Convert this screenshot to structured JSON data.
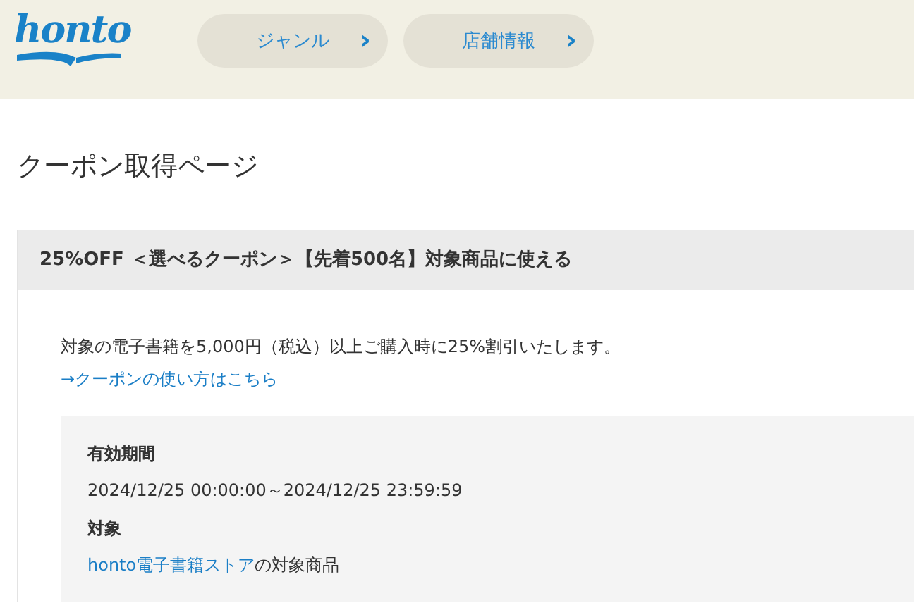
{
  "header": {
    "logo": "honto",
    "nav": [
      {
        "label": "ジャンル",
        "icon": "›"
      },
      {
        "label": "店舗情報",
        "icon": "›"
      }
    ]
  },
  "page_title": "クーポン取得ページ",
  "coupon": {
    "title": "25%OFF ＜選べるクーポン＞【先着500名】対象商品に使える",
    "description": "対象の電子書籍を5,000円（税込）以上ご購入時に25%割引いたします。",
    "help_link": "→クーポンの使い方はこちら",
    "details": [
      {
        "kind": "text",
        "label": "有効期間",
        "value": "2024/12/25 00:00:00～2024/12/25 23:59:59"
      },
      {
        "kind": "link",
        "label": "対象",
        "link": "honto電子書籍ストア",
        "value": "の対象商品"
      }
    ]
  }
}
